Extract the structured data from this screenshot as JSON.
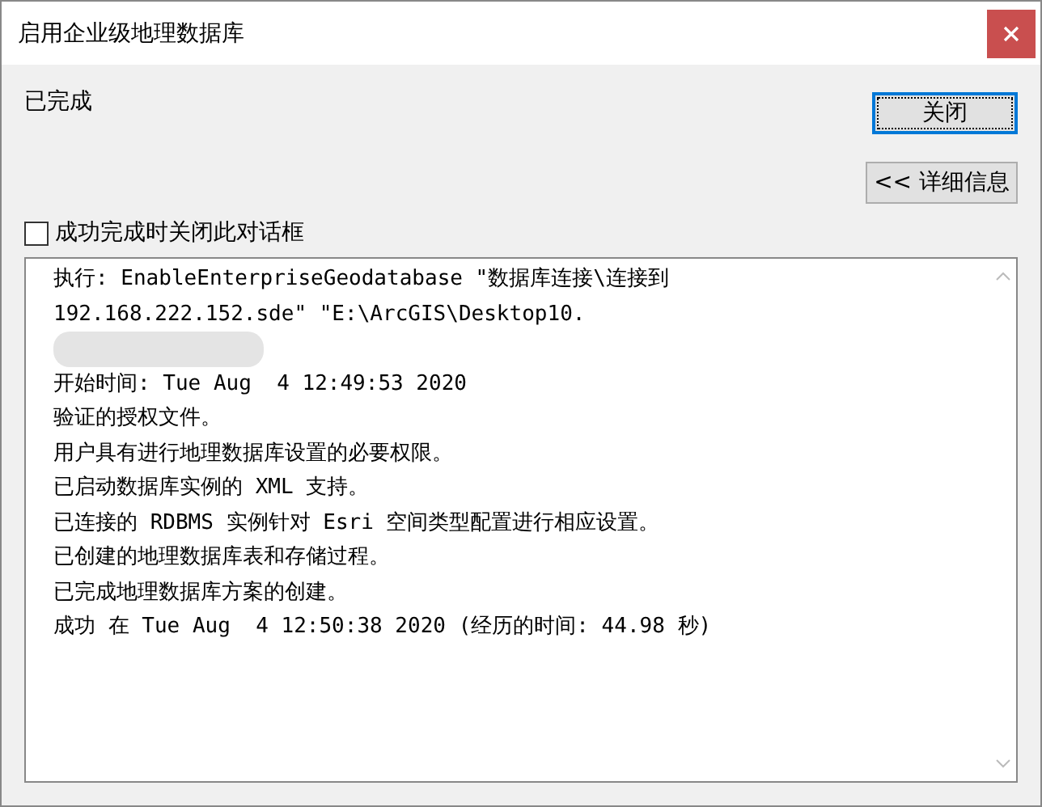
{
  "window": {
    "title": "启用企业级地理数据库"
  },
  "status": "已完成",
  "buttons": {
    "close": "关闭",
    "details": "<< 详细信息"
  },
  "close_on_success": {
    "label": "成功完成时关闭此对话框",
    "checked": false
  },
  "log": [
    {
      "kind": "text",
      "text": "执行: EnableEnterpriseGeodatabase \"数据库连接\\连接到"
    },
    {
      "kind": "text",
      "text": "192.168.222.152.sde\" \"E:\\ArcGIS\\Desktop10."
    },
    {
      "kind": "redacted"
    },
    {
      "kind": "text",
      "text": "开始时间: Tue Aug  4 12:49:53 2020"
    },
    {
      "kind": "text",
      "text": "验证的授权文件。"
    },
    {
      "kind": "text",
      "text": "用户具有进行地理数据库设置的必要权限。"
    },
    {
      "kind": "text",
      "text": "已启动数据库实例的 XML 支持。"
    },
    {
      "kind": "text",
      "text": "已连接的 RDBMS 实例针对 Esri 空间类型配置进行相应设置。"
    },
    {
      "kind": "text",
      "text": "已创建的地理数据库表和存储过程。"
    },
    {
      "kind": "text",
      "text": "已完成地理数据库方案的创建。"
    },
    {
      "kind": "text",
      "text": "成功 在 Tue Aug  4 12:50:38 2020 (经历的时间: 44.98 秒)"
    }
  ]
}
